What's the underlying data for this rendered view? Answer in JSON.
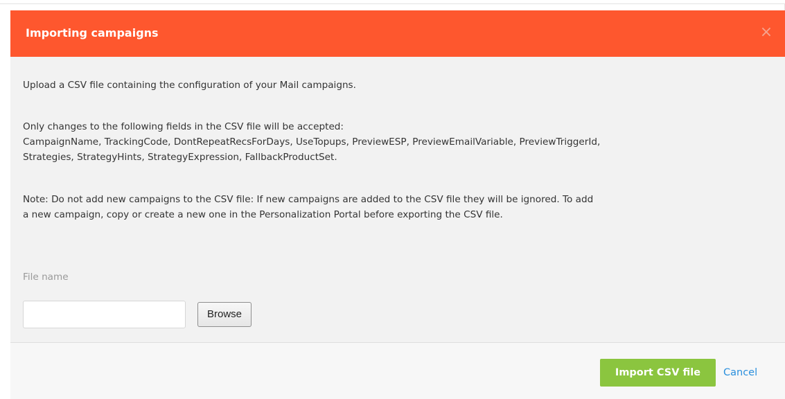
{
  "dialog": {
    "title": "Importing campaigns",
    "close_icon": "close-icon",
    "close_glyph": "×",
    "accent_color": "#fe572e"
  },
  "body": {
    "intro": "Upload a CSV file containing the configuration of your Mail campaigns.",
    "fields_heading": "Only changes to the following fields in the CSV file will be accepted:",
    "fields_line_1": "CampaignName, TrackingCode, DontRepeatRecsForDays, UseTopups, PreviewESP, PreviewEmailVariable, PreviewTriggerId,",
    "fields_line_2": "Strategies, StrategyHints, StrategyExpression, FallbackProductSet.",
    "note_line_1": "Note: Do not add new campaigns to the CSV file: If new campaigns are added to the CSV file they will be ignored. To add",
    "note_line_2": "a new campaign, copy or create a new one in the Personalization Portal before exporting the CSV file."
  },
  "file": {
    "label": "File name",
    "value": "",
    "placeholder": "",
    "browse_label": "Browse"
  },
  "footer": {
    "import_label": "Import CSV file",
    "import_color": "#8bc53f",
    "cancel_label": "Cancel",
    "cancel_color": "#2a8fdd"
  }
}
